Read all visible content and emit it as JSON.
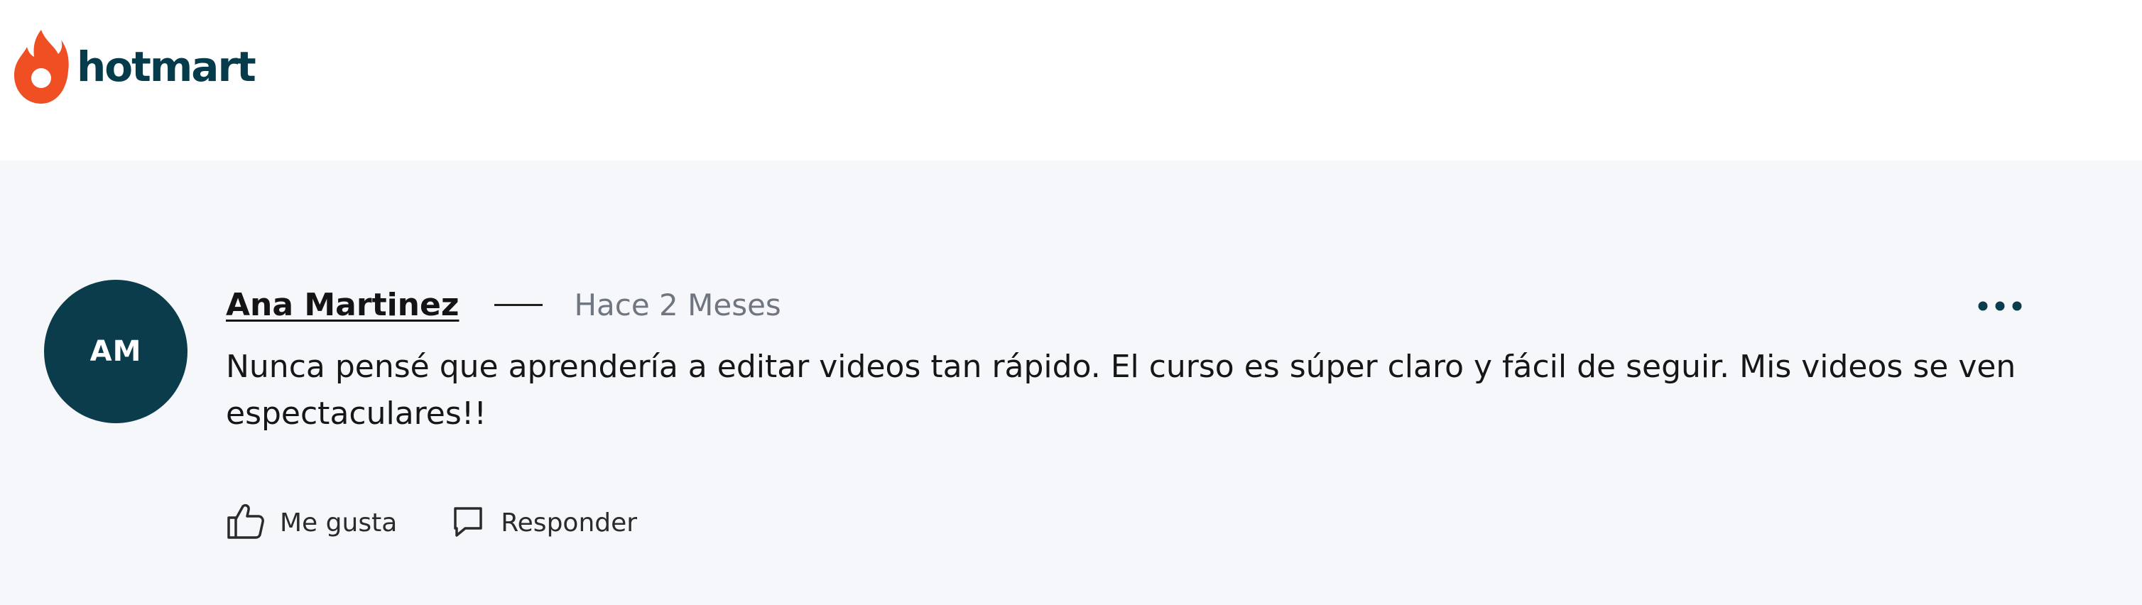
{
  "brand": {
    "name": "hotmart",
    "logo_icon": "flame-icon",
    "logo_color": "#f04e23",
    "text_color": "#053b4a"
  },
  "comment": {
    "avatar_initials": "AM",
    "avatar_color": "#0b3c4c",
    "author": "Ana Martinez",
    "time": "Hace 2 Meses",
    "text": "Nunca pensé que aprendería a editar videos tan rápido. El curso es súper claro y fácil de seguir. Mis videos se ven espectaculares!!",
    "more_icon": "more-horizontal-icon",
    "actions": {
      "like_label": "Me gusta",
      "like_icon": "thumbs-up-icon",
      "reply_label": "Responder",
      "reply_icon": "speech-bubble-icon"
    }
  },
  "colors": {
    "panel_background": "#f6f7fb",
    "header_background": "#ffffff"
  }
}
